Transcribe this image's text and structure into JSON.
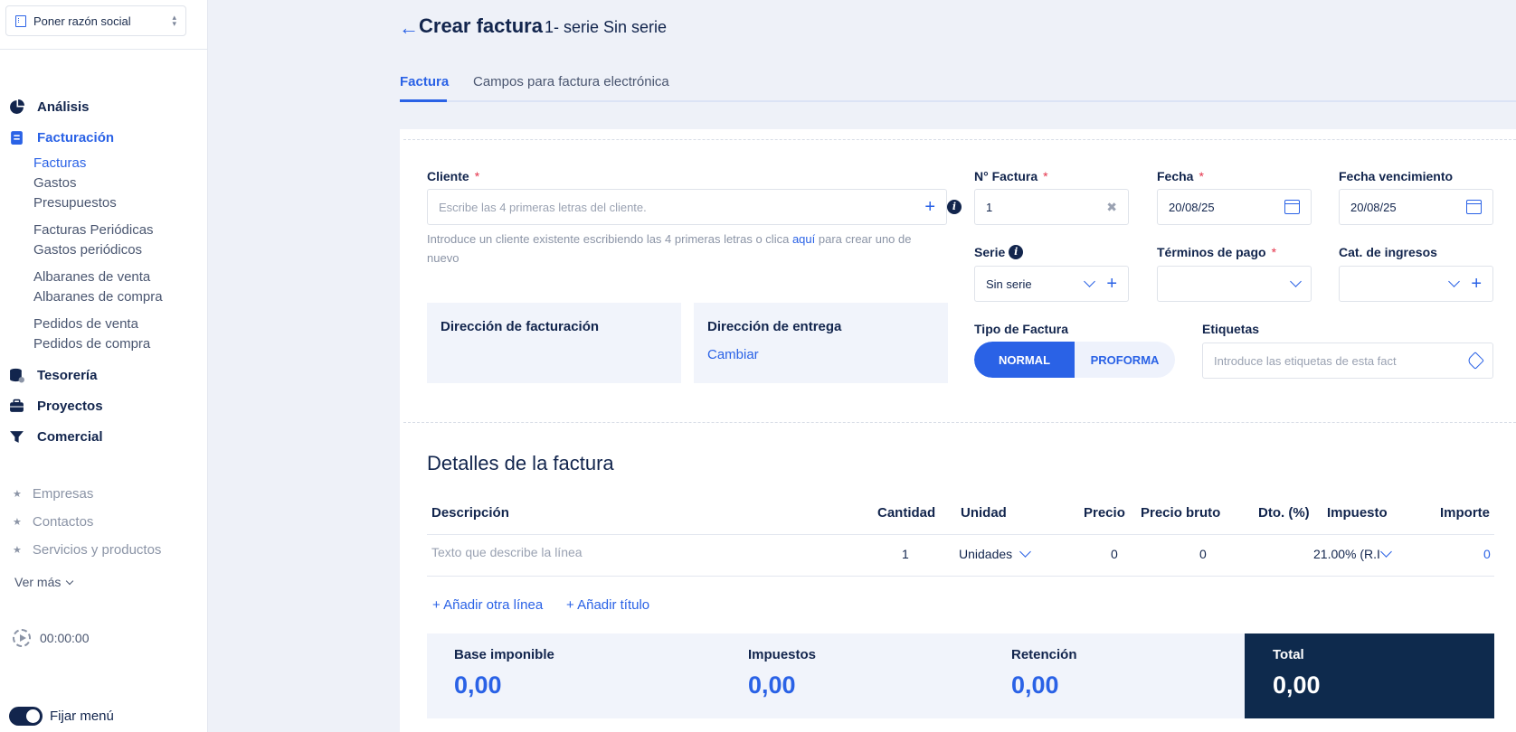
{
  "sidebar": {
    "company": "Poner razón social",
    "nav": [
      {
        "label": "Análisis"
      },
      {
        "label": "Facturación"
      },
      {
        "label": "Tesorería"
      },
      {
        "label": "Proyectos"
      },
      {
        "label": "Comercial"
      }
    ],
    "sub": [
      "Facturas",
      "Gastos",
      "Presupuestos",
      "Facturas Periódicas",
      "Gastos periódicos",
      "Albaranes de venta",
      "Albaranes de compra",
      "Pedidos de venta",
      "Pedidos de compra"
    ],
    "secondary": [
      "Empresas",
      "Contactos",
      "Servicios y productos"
    ],
    "ver_mas": "Ver más",
    "timer": "00:00:00",
    "pin_label": "Fijar menú"
  },
  "header": {
    "back": "←",
    "title": "Crear factura",
    "subtitle": "1- serie Sin serie",
    "tabs": [
      "Factura",
      "Campos para factura electrónica"
    ]
  },
  "form": {
    "cliente_label": "Cliente",
    "cliente_placeholder": "Escribe las 4 primeras letras del cliente.",
    "hint_a": "Introduce un cliente existente escribiendo las 4 primeras letras o clica ",
    "hint_link": "aquí",
    "hint_b": " para crear uno de nuevo",
    "numero_label": "N° Factura",
    "numero_value": "1",
    "fecha_label": "Fecha",
    "fecha_value": "20/08/25",
    "venc_label": "Fecha vencimiento",
    "venc_value": "20/08/25",
    "serie_label": "Serie",
    "serie_value": "Sin serie",
    "terminos_label": "Términos de pago",
    "cat_label": "Cat. de ingresos",
    "tipo_label": "Tipo de Factura",
    "tipo_options": [
      "NORMAL",
      "PROFORMA"
    ],
    "etiquetas_label": "Etiquetas",
    "etiquetas_placeholder": "Introduce las etiquetas de esta fact",
    "dir_facturacion": "Dirección de facturación",
    "dir_entrega": "Dirección de entrega",
    "cambiar": "Cambiar",
    "required_mark": "*",
    "info_mark": "i"
  },
  "details": {
    "title": "Detalles de la factura",
    "headers": [
      "Descripción",
      "Cantidad",
      "Unidad",
      "Precio",
      "Precio bruto",
      "Dto. (%)",
      "Impuesto",
      "Importe"
    ],
    "row": {
      "description_placeholder": "Texto que describe la línea",
      "cantidad": "1",
      "unidad": "Unidades",
      "precio": "0",
      "precio_bruto": "0",
      "impuesto": "21.00% (R.I",
      "importe": "0"
    },
    "add_line": "+ Añadir otra línea",
    "add_title": "+ Añadir título"
  },
  "totals": {
    "base_label": "Base imponible",
    "base_value": "0,00",
    "impuestos_label": "Impuestos",
    "impuestos_value": "0,00",
    "retencion_label": "Retención",
    "retencion_value": "0,00",
    "total_label": "Total",
    "total_value": "0,00"
  },
  "colors": {
    "accent": "#2a62e6",
    "navy": "#0e2a4d",
    "required": "#e4334a"
  }
}
